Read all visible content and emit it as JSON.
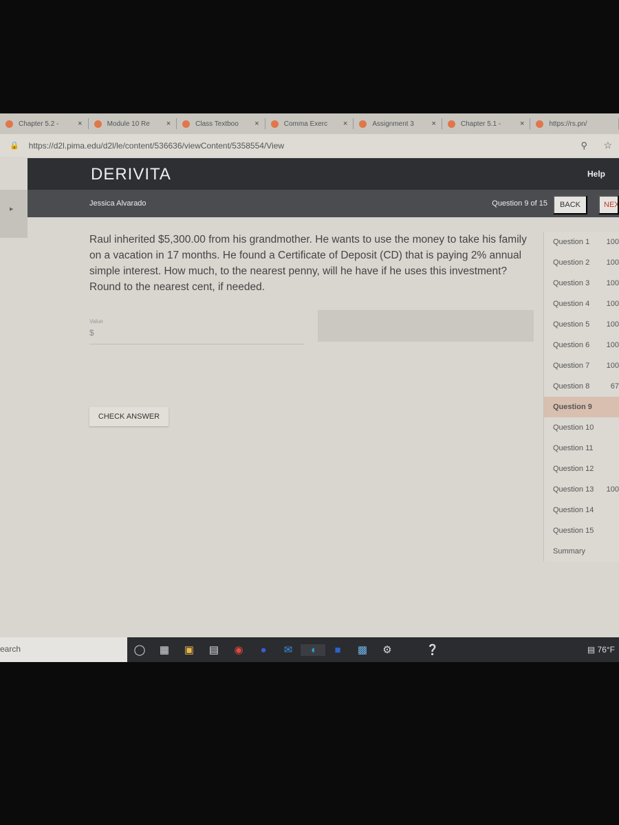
{
  "browser": {
    "tabs": [
      {
        "label": "Chapter 5.2 -"
      },
      {
        "label": "Module 10 Re"
      },
      {
        "label": "Class Textboo"
      },
      {
        "label": "Comma Exerc"
      },
      {
        "label": "Assignment 3"
      },
      {
        "label": "Chapter 5.1 -"
      },
      {
        "label": "https://rs.pn/"
      }
    ],
    "url": "https://d2l.pima.edu/d2l/le/content/536636/viewContent/5358554/View"
  },
  "header": {
    "brand": "DERIVITA",
    "help": "Help",
    "user": "Jessica Alvarado",
    "progress": "Question 9 of 15",
    "back": "BACK",
    "next": "NEXT"
  },
  "question": {
    "text": "Raul inherited $5,300.00 from his grandmother. He wants to use the money to take his family on a vacation in 17 months. He found a Certificate of Deposit (CD) that is paying 2% annual simple interest. How much, to the nearest penny, will he have if he uses this investment? Round to the nearest cent, if needed.",
    "value_label": "Value",
    "value_prefix": "$",
    "check_answer": "CHECK ANSWER"
  },
  "sidebar": {
    "items": [
      {
        "label": "Question 1",
        "score": "100"
      },
      {
        "label": "Question 2",
        "score": "100"
      },
      {
        "label": "Question 3",
        "score": "100"
      },
      {
        "label": "Question 4",
        "score": "100"
      },
      {
        "label": "Question 5",
        "score": "100"
      },
      {
        "label": "Question 6",
        "score": "100"
      },
      {
        "label": "Question 7",
        "score": "100"
      },
      {
        "label": "Question 8",
        "score": "67"
      },
      {
        "label": "Question 9",
        "score": ""
      },
      {
        "label": "Question 10",
        "score": ""
      },
      {
        "label": "Question 11",
        "score": ""
      },
      {
        "label": "Question 12",
        "score": ""
      },
      {
        "label": "Question 13",
        "score": "100"
      },
      {
        "label": "Question 14",
        "score": ""
      },
      {
        "label": "Question 15",
        "score": ""
      },
      {
        "label": "Summary",
        "score": ""
      }
    ],
    "active": "Question 9"
  },
  "taskbar": {
    "search": "earch",
    "weather": "76°F"
  }
}
